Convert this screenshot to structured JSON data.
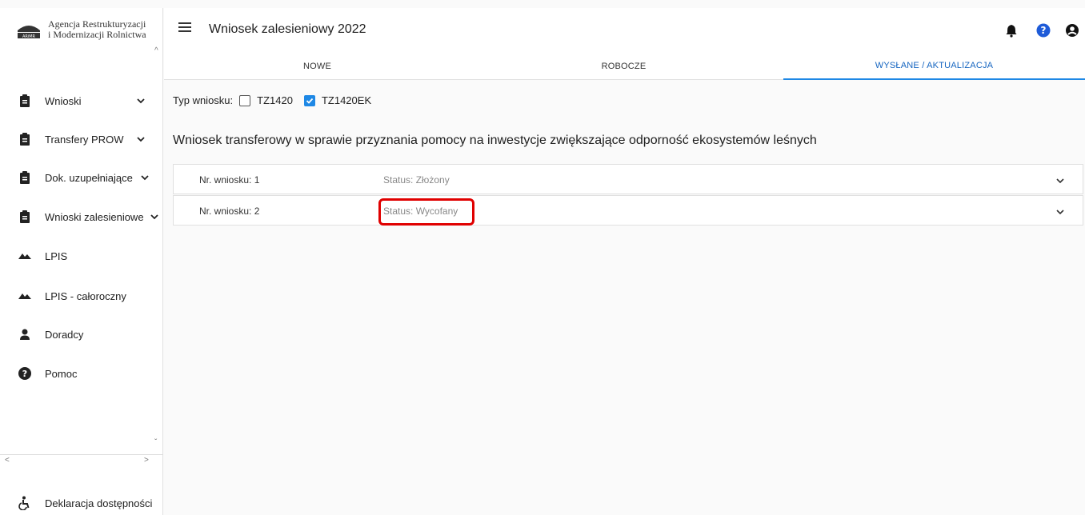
{
  "app": {
    "logo_line1": "Agencja Restrukturyzacji",
    "logo_line2": "i Modernizacji Rolnictwa",
    "logo_abbr": "ARiMR"
  },
  "header": {
    "title": "Wniosek zalesieniowy 2022",
    "icons": [
      "bell-icon",
      "help-icon",
      "account-icon"
    ]
  },
  "tabs": [
    {
      "label": "NOWE",
      "active": false
    },
    {
      "label": "ROBOCZE",
      "active": false
    },
    {
      "label": "WYSŁANE / AKTUALIZACJA",
      "active": true
    }
  ],
  "sidebar": {
    "items": [
      {
        "label": "Wnioski",
        "icon": "clipboard-icon",
        "expandable": true
      },
      {
        "label": "Transfery PROW",
        "icon": "clipboard-icon",
        "expandable": true
      },
      {
        "label": "Dok. uzupełniające",
        "icon": "clipboard-icon",
        "expandable": true
      },
      {
        "label": "Wnioski zalesieniowe",
        "icon": "clipboard-icon",
        "expandable": true
      },
      {
        "label": "LPIS",
        "icon": "terrain-icon",
        "expandable": false
      },
      {
        "label": "LPIS - całoroczny",
        "icon": "terrain-icon",
        "expandable": false
      },
      {
        "label": "Doradcy",
        "icon": "person-icon",
        "expandable": false
      },
      {
        "label": "Pomoc",
        "icon": "help-circle-icon",
        "expandable": false
      }
    ],
    "footer_label": "Deklaracja dostępności"
  },
  "filter": {
    "label": "Typ wniosku:",
    "options": [
      {
        "label": "TZ1420",
        "checked": false
      },
      {
        "label": "TZ1420EK",
        "checked": true
      }
    ]
  },
  "section_title": "Wniosek transferowy w sprawie przyznania pomocy na inwestycje zwiększające odporność ekosystemów leśnych",
  "applications": [
    {
      "number": "Nr. wniosku: 1",
      "status": "Status: Złożony"
    },
    {
      "number": "Nr. wniosku: 2",
      "status": "Status: Wycofany"
    }
  ],
  "colors": {
    "accent": "#1e88e5",
    "highlight": "#e00000"
  }
}
